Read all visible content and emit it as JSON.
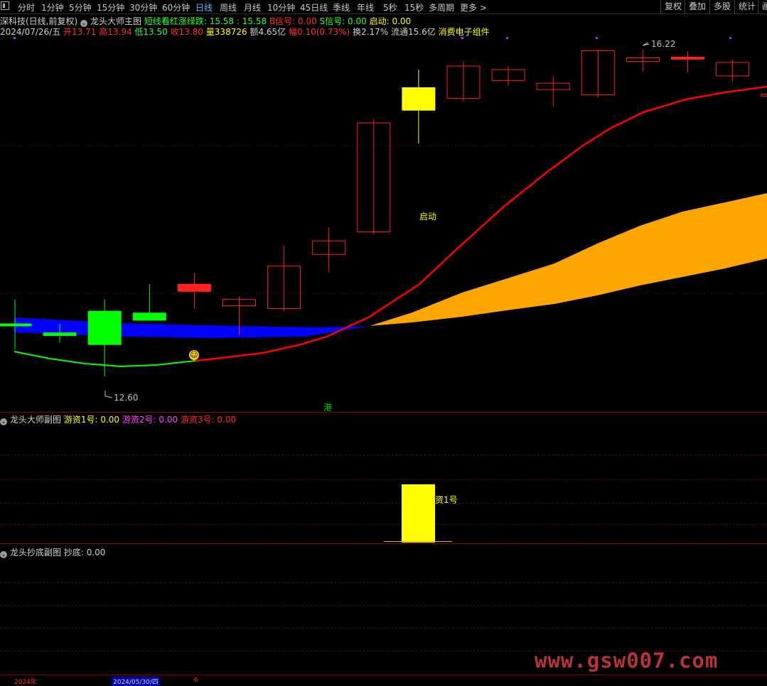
{
  "toolbar": {
    "periods": [
      "分时",
      "1分钟",
      "5分钟",
      "15分钟",
      "30分钟",
      "60分钟",
      "日线",
      "周线",
      "月线",
      "10分钟",
      "45日线",
      "季线",
      "年线",
      "5秒",
      "15秒",
      "多周期",
      "更多 >"
    ],
    "active_period": "日线",
    "right_buttons": [
      "复权",
      "叠加",
      "多股",
      "统计",
      "画"
    ]
  },
  "header": {
    "stock_title": "深科技(日线,前复权)",
    "indicator_name": "龙头大师主图",
    "indicator_line": "短线看红涨绿跌: 15.58 : 15.58",
    "b_signal": "B信号: 0.00",
    "s_signal": "S信号: 0.00",
    "start_signal": "启动: 0.00"
  },
  "quote": {
    "date": "2024/07/26/五",
    "open": "开13.71",
    "high": "高13.94",
    "low": "低13.50",
    "close": "收13.80",
    "volume": "量338726",
    "amount": "额4.65亿",
    "change": "幅0.10(0.73%)",
    "turnover": "换2.17%",
    "float": "流通15.6亿",
    "sector": "消费电子组件"
  },
  "main_chart": {
    "high_label": "16.22",
    "low_label": "12.60",
    "start_label": "启动",
    "hk_label": "港",
    "colors": {
      "up": "#ff2020",
      "down": "#00ff00",
      "signal": "#ffff00",
      "band_up": "#ffa500",
      "band_down": "#0000ff",
      "ma": "#ff0000",
      "ma_down": "#00ff00"
    }
  },
  "sub_chart1": {
    "name": "龙头大师副图",
    "youzi1": "游资1号: 0.00",
    "youzi2": "游资2号: 0.00",
    "youzi3": "游资3号: 0.00",
    "bar_label": "资1号"
  },
  "sub_chart2": {
    "name": "龙头抄底副图",
    "chaodi": "抄底: 0.00"
  },
  "footer": {
    "year": "2024年",
    "date": "2024/05/30/四",
    "num": "6"
  },
  "watermark": "www.gsw007.com",
  "chart_data": {
    "type": "candlestick",
    "candles": [
      {
        "o": 13.18,
        "h": 13.45,
        "l": 12.9,
        "c": 13.18,
        "color": "green"
      },
      {
        "o": 13.08,
        "h": 13.18,
        "l": 12.97,
        "c": 13.05,
        "color": "green"
      },
      {
        "o": 13.32,
        "h": 13.45,
        "l": 12.6,
        "c": 12.95,
        "color": "green"
      },
      {
        "o": 13.3,
        "h": 13.62,
        "l": 13.22,
        "c": 13.22,
        "color": "green"
      },
      {
        "o": 13.62,
        "h": 13.75,
        "l": 13.35,
        "c": 13.54,
        "color": "red"
      },
      {
        "o": 13.38,
        "h": 13.48,
        "l": 13.05,
        "c": 13.45,
        "color": "red"
      },
      {
        "o": 13.35,
        "h": 14.05,
        "l": 13.32,
        "c": 13.82,
        "color": "red"
      },
      {
        "o": 13.95,
        "h": 14.25,
        "l": 13.76,
        "c": 14.1,
        "color": "red"
      },
      {
        "o": 14.2,
        "h": 15.45,
        "l": 14.17,
        "c": 15.41,
        "color": "red"
      },
      {
        "o": 15.55,
        "h": 16.0,
        "l": 15.18,
        "c": 15.8,
        "color": "yellow"
      },
      {
        "o": 15.68,
        "h": 16.09,
        "l": 15.65,
        "c": 16.04,
        "color": "red"
      },
      {
        "o": 15.88,
        "h": 16.04,
        "l": 15.82,
        "c": 16.0,
        "color": "red"
      },
      {
        "o": 15.78,
        "h": 15.93,
        "l": 15.59,
        "c": 15.85,
        "color": "red"
      },
      {
        "o": 15.72,
        "h": 16.22,
        "l": 15.69,
        "c": 16.21,
        "color": "red"
      },
      {
        "o": 16.09,
        "h": 16.22,
        "l": 15.98,
        "c": 16.13,
        "color": "red"
      },
      {
        "o": 16.14,
        "h": 16.2,
        "l": 15.97,
        "c": 16.12,
        "color": "red"
      },
      {
        "o": 15.93,
        "h": 16.11,
        "l": 15.87,
        "c": 16.08,
        "color": "red"
      },
      {
        "o": 15.72,
        "h": 16.06,
        "l": 15.66,
        "c": 15.73,
        "color": "red"
      }
    ],
    "ylim": [
      12.4,
      16.3
    ],
    "sub1_bar": 1
  }
}
